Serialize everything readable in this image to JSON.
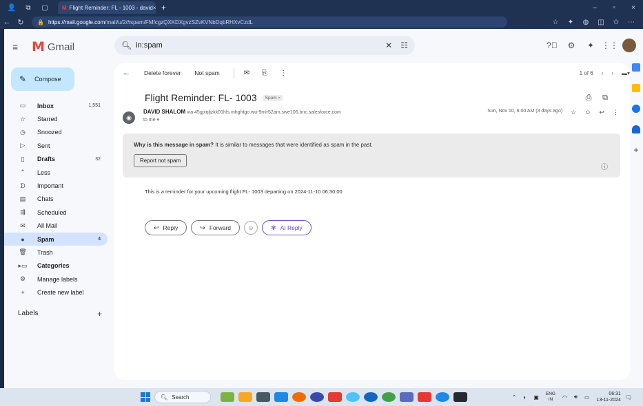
{
  "browser": {
    "tab_title": "Flight Reminder: FL - 1003 - david",
    "url_domain": "https://mail.google.com",
    "url_path": "/mail/u/2/#spam/FMfcgzQXKDXgvzSZvKVNbDqbRHXvCzdL"
  },
  "header": {
    "logo_text": "Gmail",
    "search_value": "in:spam"
  },
  "sidebar": {
    "compose_label": "Compose",
    "items": [
      {
        "label": "Inbox",
        "count": "1,551",
        "icon": "inbox-icon",
        "glyph": "▭",
        "bold": true
      },
      {
        "label": "Starred",
        "count": "",
        "icon": "star-icon",
        "glyph": "☆",
        "bold": false
      },
      {
        "label": "Snoozed",
        "count": "",
        "icon": "clock-icon",
        "glyph": "◷",
        "bold": false
      },
      {
        "label": "Sent",
        "count": "",
        "icon": "send-icon",
        "glyph": "▷",
        "bold": false
      },
      {
        "label": "Drafts",
        "count": "32",
        "icon": "draft-icon",
        "glyph": "▯",
        "bold": true
      },
      {
        "label": "Less",
        "count": "",
        "icon": "chevron-up-icon",
        "glyph": "⌃",
        "bold": false
      },
      {
        "label": "Important",
        "count": "",
        "icon": "label-important-icon",
        "glyph": "ᗤ",
        "bold": false
      },
      {
        "label": "Chats",
        "count": "",
        "icon": "chat-icon",
        "glyph": "▤",
        "bold": false
      },
      {
        "label": "Scheduled",
        "count": "",
        "icon": "scheduled-send-icon",
        "glyph": "⇶",
        "bold": false
      },
      {
        "label": "All Mail",
        "count": "",
        "icon": "all-mail-icon",
        "glyph": "✉",
        "bold": false
      },
      {
        "label": "Spam",
        "count": "4",
        "icon": "spam-icon",
        "glyph": "●",
        "bold": true
      },
      {
        "label": "Trash",
        "count": "",
        "icon": "trash-icon",
        "glyph": "🗑",
        "bold": false
      },
      {
        "label": "Categories",
        "count": "",
        "icon": "categories-icon",
        "glyph": "▸▭",
        "bold": true
      },
      {
        "label": "Manage labels",
        "count": "",
        "icon": "settings-icon",
        "glyph": "⚙",
        "bold": false
      },
      {
        "label": "Create new label",
        "count": "",
        "icon": "plus-icon",
        "glyph": "+",
        "bold": false
      }
    ],
    "labels_heading": "Labels"
  },
  "toolbar": {
    "delete_forever": "Delete forever",
    "not_spam": "Not spam",
    "pagination": "1 of 6"
  },
  "email": {
    "subject": "Flight Reminder: FL- 1003",
    "badge": "Spam ×",
    "sender_name": "DAVID SHALOM",
    "sender_via": "via 45gjxqljzkk01hls.mhghtgo.wu-9mir52am.swe106.bnc.salesforce.com",
    "to": "to me ▾",
    "date": "Sun, Nov 10, 6:00 AM (3 days ago)",
    "spam_reason_bold": "Why is this message in spam?",
    "spam_reason": " It is similar to messages that were identified as spam in the past.",
    "report_not_spam": "Report not spam",
    "body": "This is a reminder for your upcoming flight FL- 1003 departing on 2024-11-10 06:30:00",
    "reply": "Reply",
    "forward": "Forward",
    "ai_reply": "AI Reply"
  },
  "taskbar": {
    "search_label": "Search",
    "lang_top": "ENG",
    "lang_bottom": "IN",
    "time": "06:31",
    "date": "13-11-2024"
  },
  "colors": {
    "accent": "#c2e7ff",
    "active_nav": "#d3e3fd",
    "gmail_red": "#ea4335"
  }
}
